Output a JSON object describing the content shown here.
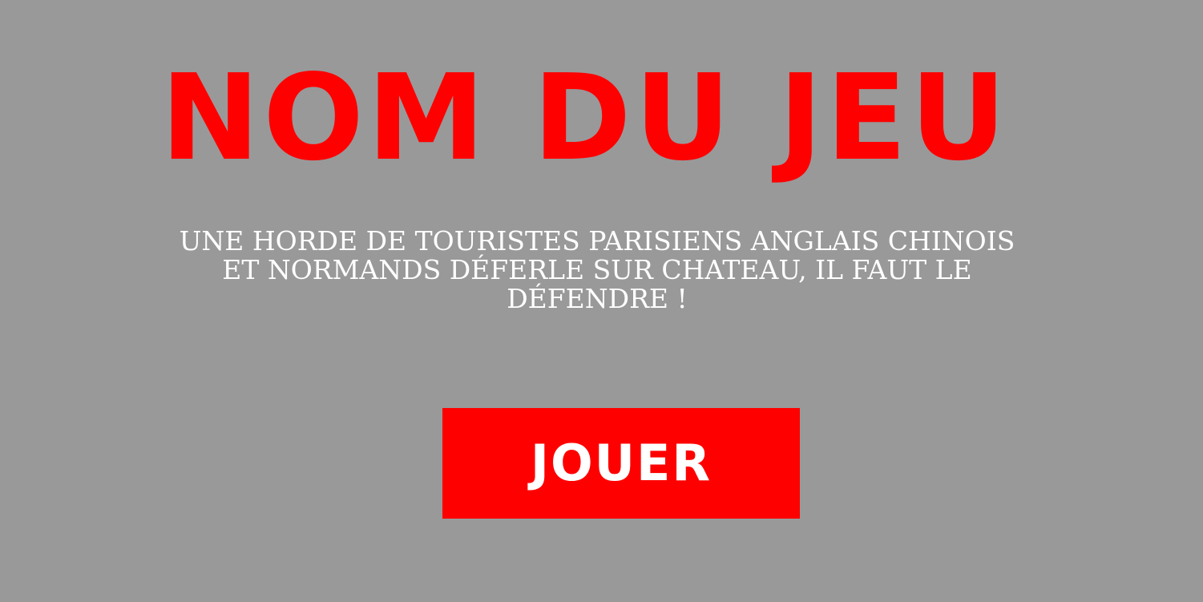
{
  "game": {
    "title": "NOM DU JEU",
    "tagline": "Une horde de touristes parisiens anglais chinois et normands déferle sur chateau, il faut le défendre !"
  },
  "actions": {
    "play_label": "JOUER"
  },
  "colors": {
    "background": "#999999",
    "accent": "#ff0000",
    "text_light": "#ffffff"
  }
}
